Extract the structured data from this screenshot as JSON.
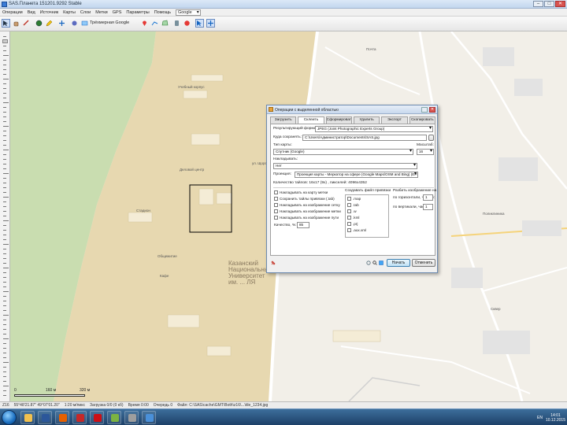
{
  "window": {
    "title": "SAS.Планета 151201.9292 Stable",
    "controls": [
      "–",
      "□",
      "✕"
    ]
  },
  "menu": {
    "items": [
      "Операции",
      "Вид",
      "Источник",
      "Карты",
      "Слои",
      "Метки",
      "GPS",
      "Параметры",
      "Помощь"
    ],
    "map_combo": "Google"
  },
  "toolbar": {
    "layer_text": "Трёхмерная Google",
    "icons": [
      "select-arrow-icon",
      "pan-hand-icon",
      "ruler-icon",
      "edit-pencil-icon",
      "globe-icon",
      "zoom-in-icon",
      "grid-icon",
      "satellite-icon",
      "layers-icon",
      "marker-icon",
      "route-icon",
      "polygon-icon",
      "gps-icon",
      "cursor-icon",
      "move-icon"
    ]
  },
  "map": {
    "labels": {
      "road_label_1": "Деловой центр",
      "road_label_2": "ул. Щорса",
      "building_label_1": "Казанский национальный университет им. ...",
      "building_label_2": "Учебный корпус",
      "poi_1": "Стадион",
      "poi_2": "Общежитие",
      "poi_3": "Кафе",
      "poi_4": "Поликлиника",
      "poi_5": "Сквер",
      "poi_6": "Почта",
      "university": "Казанский\nНациональный\nУниверситет\nим. ... ЛЯ"
    },
    "scale": {
      "start": "0",
      "mid": "160 м",
      "end": "320 м"
    }
  },
  "status": {
    "items": [
      "Z16",
      "55°48'21.87\" 49°07'01.20\"",
      "1:20 м/пикс",
      "Загрузка 0/0 (0 кб)",
      "Время 0:00",
      "Очередь 0",
      "Файл: C:\\SAS\\cache\\GMT\\Both\\z16\\...\\tile_1234.jpg"
    ]
  },
  "dialog": {
    "title": "Операции с выделенной областью",
    "close": "✕",
    "tabs": [
      "Загрузить",
      "Склеить",
      "Сформировать",
      "Удалить",
      "Экспорт",
      "Скопировать"
    ],
    "active_tab": "Склеить",
    "format_label": "Результирующий формат:",
    "format_value": "JPEG (Joint Photographic Experts Group)",
    "path_label": "Куда сохранять:",
    "path_value": "C:\\Users\\Администратор\\Documents\\SAS.jpg",
    "map_label": "Тип карты:",
    "map_value": "Спутник (Google)",
    "zoom_label": "Масштаб:",
    "zoom_value": "16",
    "layer_label": "Накладывать:",
    "layer_value": "Нет",
    "projection_label": "Проекция:",
    "projection_value": "Проекция карты - Меркатор на сфере (Google Maps/OSM and Bing) (EPSG:3785)",
    "tiles_info": "Количество тайлов: 16x17 (9x) , пикселей: 4096x4352",
    "options": [
      "Накладывать на карту метки",
      "Сохранить тайлы привязки (.tab)",
      "Накладывать на изображение сетку",
      "Накладывать на изображение метки",
      "Накладывать на изображение пути"
    ],
    "quality_label": "Качество, %:",
    "quality_value": "85",
    "world_files_label": "Создавать файл привязки",
    "world_files": [
      ".map",
      ".tab",
      ".w",
      ".kml",
      ".prj",
      ".aux.xml"
    ],
    "tiles_split_label": "Разбить изображение на",
    "h_parts_label": "по горизонтали, частей:",
    "h_parts_value": "1",
    "v_parts_label": "по вертикали, частей:",
    "v_parts_value": "1",
    "start_button": "Начать",
    "cancel_button": "Отменить"
  },
  "taskbar": {
    "lang": "EN",
    "time": "14:01",
    "date": "10.12.2015",
    "apps": [
      {
        "icon": "explorer-icon",
        "color": "#f2c14e"
      },
      {
        "icon": "word-icon",
        "color": "#2b579a"
      },
      {
        "icon": "firefox-icon",
        "color": "#e66000"
      },
      {
        "icon": "acrobat-icon",
        "color": "#c62828"
      },
      {
        "icon": "opera-icon",
        "color": "#cc0f16"
      },
      {
        "icon": "paint-icon",
        "color": "#7cb342"
      },
      {
        "icon": "calc-icon",
        "color": "#9e9e9e"
      },
      {
        "icon": "sasplanet-icon",
        "color": "#4a90d9"
      }
    ]
  }
}
